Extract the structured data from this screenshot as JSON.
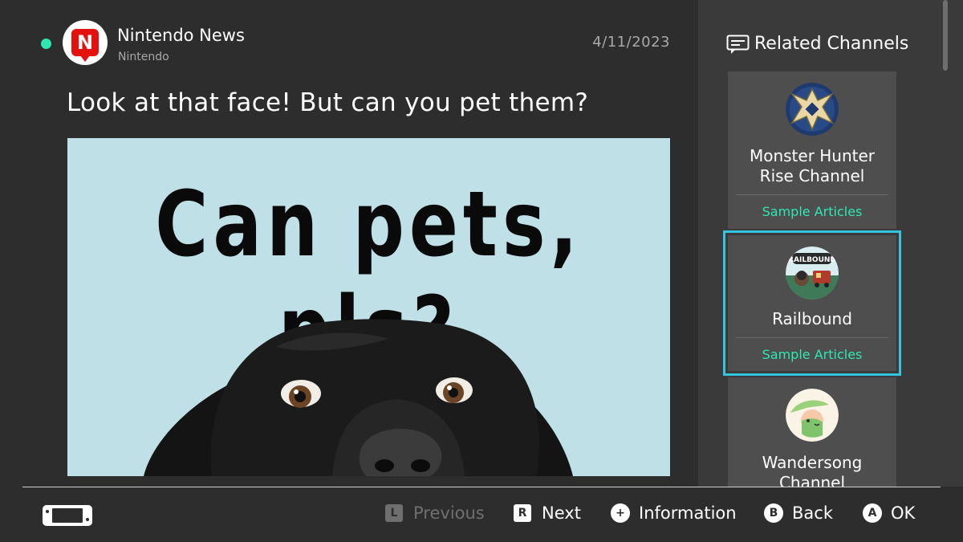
{
  "article": {
    "channel_name": "Nintendo News",
    "publisher": "Nintendo",
    "date": "4/11/2023",
    "headline": "Look at that face! But can you pet them?",
    "logo_letter": "N",
    "image_caption": "Can pets, pls?",
    "image_subject": "black-labrador-dog"
  },
  "sidebar": {
    "title": "Related Channels",
    "channels": [
      {
        "name": "Monster Hunter Rise Channel",
        "link": "Sample Articles",
        "icon": "monster-hunter-emblem",
        "selected": false
      },
      {
        "name": "Railbound",
        "link": "Sample Articles",
        "icon": "railbound-badge",
        "badge_text": "RAILBOUND",
        "selected": true
      },
      {
        "name": "Wandersong Channel",
        "link": "",
        "icon": "wandersong-bard",
        "selected": false
      }
    ]
  },
  "footer": {
    "hints": [
      {
        "button": "L",
        "label": "Previous",
        "enabled": false
      },
      {
        "button": "R",
        "label": "Next",
        "enabled": true
      },
      {
        "button": "+",
        "label": "Information",
        "enabled": true
      },
      {
        "button": "B",
        "label": "Back",
        "enabled": true
      },
      {
        "button": "A",
        "label": "OK",
        "enabled": true
      }
    ]
  },
  "colors": {
    "background": "#2d2d2d",
    "sidebar": "#3a3a3a",
    "card": "#4e4e4e",
    "accent_green": "#2ee8b0",
    "selection_cyan": "#33c4e0",
    "logo_red": "#e4120e",
    "image_bg": "#bfe0e6"
  }
}
